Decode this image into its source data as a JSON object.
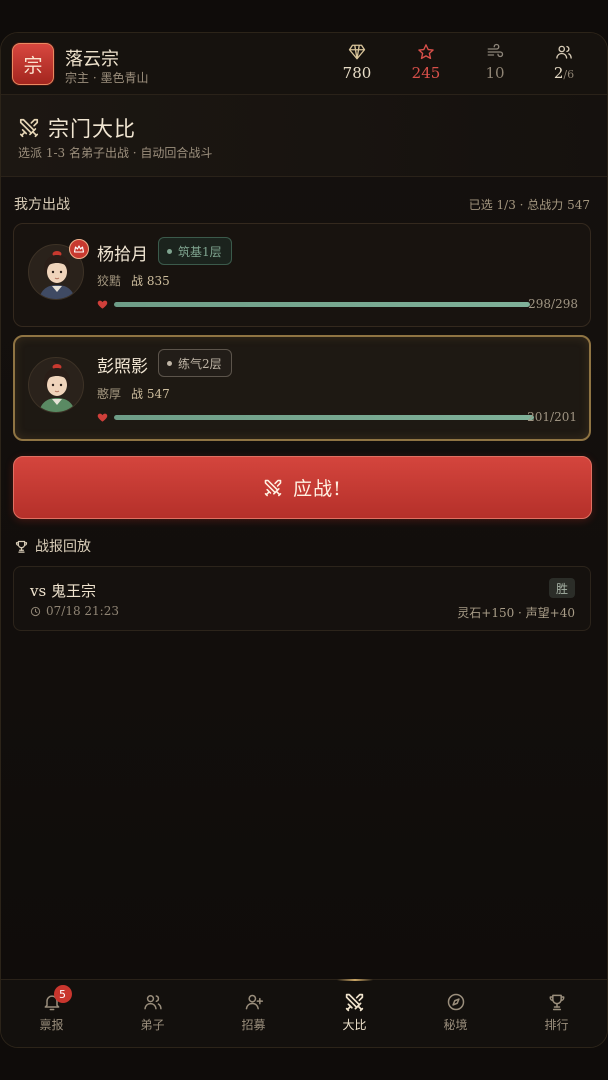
{
  "header": {
    "logo_char": "宗",
    "sect_name": "落云宗",
    "sect_sub": "宗主 · 墨色青山",
    "stats": {
      "diamond": "780",
      "star": "245",
      "wind": "10",
      "disciples": "2",
      "disciples_max": "/6"
    }
  },
  "banner": {
    "title": "宗门大比",
    "subtitle": "选派 1-3 名弟子出战 · 自动回合战斗"
  },
  "our_team": {
    "label": "我方出战",
    "summary": "已选 1/3 · 总战力 547",
    "fighters": [
      {
        "name": "杨拾月",
        "realm": "筑基1层",
        "trait": "狡黠",
        "power_label": "战",
        "power": "835",
        "hp_text": "298/298",
        "hp_ratio": 1.0
      },
      {
        "name": "彭照影",
        "realm": "练气2层",
        "trait": "憨厚",
        "power_label": "战",
        "power": "547",
        "hp_text": "201/201",
        "hp_ratio": 1.0
      }
    ]
  },
  "fight_button": {
    "label": "应战!"
  },
  "reports": {
    "label": "战报回放",
    "items": [
      {
        "vs": "vs 鬼王宗",
        "time": "07/18 21:23",
        "result": "胜",
        "reward": "灵石+150 · 声望+40"
      }
    ]
  },
  "nav": {
    "items": [
      {
        "label": "禀报",
        "badge": "5"
      },
      {
        "label": "弟子"
      },
      {
        "label": "招募"
      },
      {
        "label": "大比"
      },
      {
        "label": "秘境"
      },
      {
        "label": "排行"
      }
    ]
  },
  "colors": {
    "accent_red": "#d4453d",
    "gold": "#c9a565",
    "hp_green": "#7fb199",
    "star_red": "#d9504a"
  }
}
